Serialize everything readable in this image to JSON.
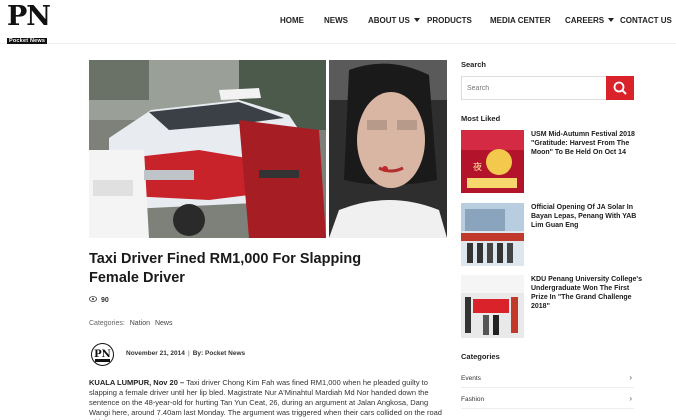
{
  "site": {
    "logo_mark": "PN",
    "logo_sub": "Pocket News"
  },
  "nav": {
    "items": [
      {
        "label": "HOME",
        "dropdown": false
      },
      {
        "label": "NEWS",
        "dropdown": false
      },
      {
        "label": "ABOUT US",
        "dropdown": true
      },
      {
        "label": "PRODUCTS",
        "dropdown": false
      },
      {
        "label": "MEDIA CENTER",
        "dropdown": false
      },
      {
        "label": "CAREERS",
        "dropdown": true
      },
      {
        "label": "CONTACT US",
        "dropdown": false
      }
    ]
  },
  "article": {
    "title": "Taxi Driver Fined RM1,000 For Slapping Female Driver",
    "views": "90",
    "categories_label": "Categories:",
    "categories": [
      "Nation",
      "News"
    ],
    "date": "November 21, 2014",
    "byline": "By: Pocket News",
    "lead_location": "KUALA LUMPUR, Nov 20 –",
    "body": "Taxi driver Chong Kim Fah was fined RM1,000 when he pleaded guilty to slapping a female driver until her lip bled.  Magistrate Nur A'Minahtul Mardiah Md Nor handed down the sentence on the 48-year-old for hurting Tan Yun Ceat, 26, during an argument at Jalan Angkosa, Dang Wangi here, around 7.40am last Monday. The argument was triggered when their cars collided on the road which was congested"
  },
  "sidebar": {
    "search_heading": "Search",
    "search_placeholder": "Search",
    "most_liked_heading": "Most Liked",
    "most_liked": [
      {
        "title": "USM Mid-Autumn Festival 2018 \"Gratitude: Harvest From The Moon\" To Be Held On Oct 14"
      },
      {
        "title": "Official Opening Of JA Solar In Bayan Lepas, Penang With YAB Lim Guan Eng"
      },
      {
        "title": "KDU Penang University College's Undergraduate Won The First Prize In \"The Grand Challenge 2018\""
      }
    ],
    "categories_heading": "Categories",
    "categories": [
      "Events",
      "Fashion"
    ]
  },
  "colors": {
    "accent": "#d9222a",
    "taxi_red": "#c8232b"
  }
}
